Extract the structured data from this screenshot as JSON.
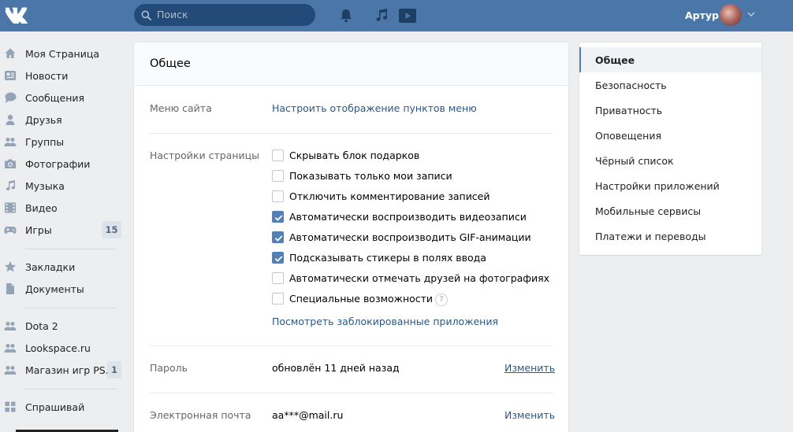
{
  "header": {
    "search_placeholder": "Поиск",
    "user_name": "Артур"
  },
  "sidebar": {
    "items": [
      {
        "label": "Моя Страница",
        "icon": "home-icon"
      },
      {
        "label": "Новости",
        "icon": "news-icon"
      },
      {
        "label": "Сообщения",
        "icon": "messages-icon"
      },
      {
        "label": "Друзья",
        "icon": "friend-icon"
      },
      {
        "label": "Группы",
        "icon": "groups-icon"
      },
      {
        "label": "Фотографии",
        "icon": "camera-icon"
      },
      {
        "label": "Музыка",
        "icon": "music-icon"
      },
      {
        "label": "Видео",
        "icon": "video-icon"
      },
      {
        "label": "Игры",
        "icon": "gamepad-icon",
        "badge": "15"
      },
      {
        "label": "Закладки",
        "icon": "star-icon"
      },
      {
        "label": "Документы",
        "icon": "document-icon"
      },
      {
        "label": "Dota 2",
        "icon": "app-icon"
      },
      {
        "label": "Lookspace.ru",
        "icon": "app-icon"
      },
      {
        "label": "Магазин игр PS...",
        "icon": "app-icon",
        "badge": "1"
      },
      {
        "label": "Спрашивай",
        "icon": "grid-icon"
      }
    ]
  },
  "settings": {
    "title": "Общее",
    "menu_label": "Меню сайта",
    "menu_link": "Настроить отображение пунктов меню",
    "page_label": "Настройки страницы",
    "checkboxes": [
      {
        "label": "Скрывать блок подарков",
        "checked": false
      },
      {
        "label": "Показывать только мои записи",
        "checked": false
      },
      {
        "label": "Отключить комментирование записей",
        "checked": false
      },
      {
        "label": "Автоматически воспроизводить видеозаписи",
        "checked": true
      },
      {
        "label": "Автоматически воспроизводить GIF-анимации",
        "checked": true
      },
      {
        "label": "Подсказывать стикеры в полях ввода",
        "checked": true
      },
      {
        "label": "Автоматически отмечать друзей на фотографиях",
        "checked": false
      },
      {
        "label": "Специальные возможности",
        "checked": false
      }
    ],
    "help_symbol": "?",
    "blocked_apps_link": "Посмотреть заблокированные приложения",
    "password_label": "Пароль",
    "password_value": "обновлён 11 дней назад",
    "password_change": "Изменить",
    "email_label": "Электронная почта",
    "email_value": "aa***@mail.ru",
    "email_change": "Изменить"
  },
  "right_menu": {
    "active_index": 0,
    "items": [
      "Общее",
      "Безопасность",
      "Приватность",
      "Оповещения",
      "Чёрный список",
      "Настройки приложений",
      "Мобильные сервисы",
      "Платежи и переводы"
    ]
  },
  "colors": {
    "header_bg": "#4a76a8",
    "accent": "#5181b8",
    "link": "#2a5885"
  }
}
